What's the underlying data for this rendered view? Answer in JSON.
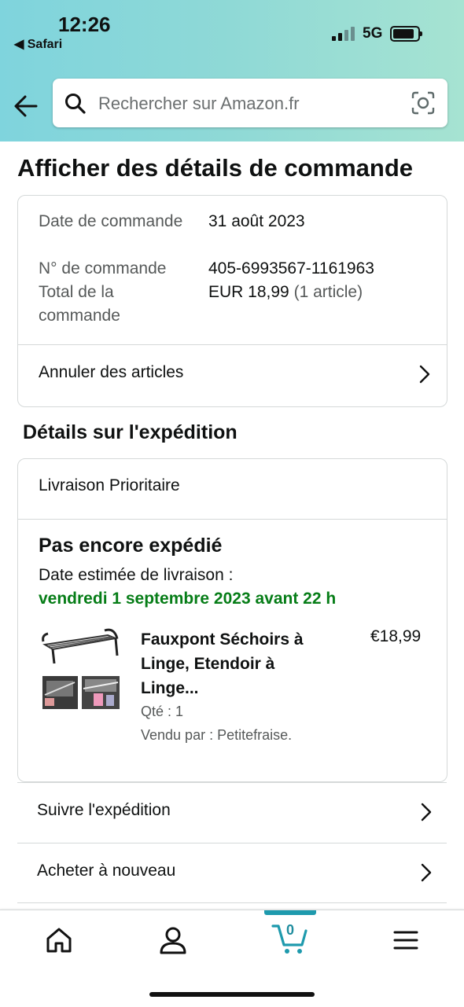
{
  "status_bar": {
    "time": "12:26",
    "back_app": "Safari",
    "network": "5G"
  },
  "search": {
    "placeholder": "Rechercher sur Amazon.fr"
  },
  "page_title": "Afficher des détails de commande",
  "order_summary": {
    "date_label": "Date de commande",
    "date_value": "31 août 2023",
    "number_label": "N° de commande",
    "number_value": "405-6993567-1161963",
    "total_label": "Total de la commande",
    "total_value": "EUR 18,99",
    "total_items": "(1 article)",
    "cancel_label": "Annuler des articles"
  },
  "shipment": {
    "section_title": "Détails sur l'expédition",
    "shipping_method": "Livraison Prioritaire",
    "status": "Pas encore expédié",
    "estimate_label": "Date estimée de livraison :",
    "estimate_date": "vendredi 1 septembre 2023 avant 22 h",
    "product": {
      "name": "Fauxpont Séchoirs à Linge, Etendoir à Linge...",
      "price": "€18,99",
      "qty": "Qté : 1",
      "seller": "Vendu par : Petitefraise."
    }
  },
  "actions": [
    {
      "label": "Suivre l'expédition"
    },
    {
      "label": "Acheter à nouveau"
    }
  ],
  "tabbar": {
    "cart_count": "0",
    "accent_color": "#1e9aad"
  },
  "colors": {
    "delivery_green": "#067d17",
    "header_gradient_start": "#7fd4dd",
    "header_gradient_end": "#a6e3d2"
  },
  "icons": [
    "back-arrow-icon",
    "search-icon",
    "camera-lens-icon",
    "chevron-right-icon",
    "home-icon",
    "account-icon",
    "cart-icon",
    "menu-icon"
  ]
}
